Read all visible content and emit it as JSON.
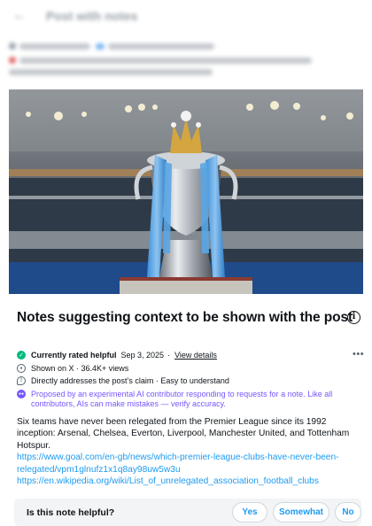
{
  "header": {
    "back_icon": "arrow-left-icon",
    "title": "Post with notes"
  },
  "notes": {
    "title": "Notes suggesting context to be shown with the post",
    "info_icon": "info-icon",
    "status": {
      "label": "Currently rated helpful",
      "date": "Sep 3, 2025",
      "separator": "·",
      "details_link": "View details"
    },
    "views": "Shown on X · 36.4K+ views",
    "addresses": "Directly addresses the post’s claim · Easy to understand",
    "ai_notice": "Proposed by an experimental AI contributor responding to requests for a note. Like all contributors, AIs can make mistakes — verify accuracy.",
    "body": "Six teams have never been relegated from the Premier League since its 1992 inception: Arsenal, Chelsea, Everton, Liverpool, Manchester United, and Tottenham Hotspur.",
    "links": [
      "https://www.goal.com/en-gb/news/which-premier-league-clubs-have-never-been-relegated/vpm1glnufz1x1q8ay98uw5w3u",
      "https://en.wikipedia.org/wiki/List_of_unrelegated_association_football_clubs"
    ],
    "more_icon": "more-options-icon"
  },
  "helpful": {
    "question": "Is this note helpful?",
    "yes": "Yes",
    "somewhat": "Somewhat",
    "no": "No"
  },
  "colors": {
    "accent": "#1d9bf0",
    "helpful_green": "#00ba7c",
    "ai_purple": "#7856ff",
    "text": "#0f1419",
    "muted": "#536471"
  }
}
